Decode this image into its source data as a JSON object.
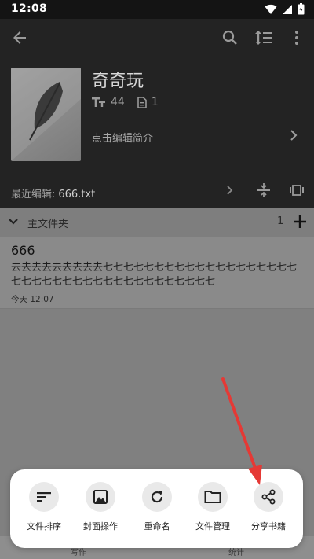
{
  "status_bar": {
    "time": "12:08"
  },
  "toolbar": {
    "icons": [
      "back-arrow-icon",
      "search-icon",
      "sort-icon",
      "more-vert-icon"
    ]
  },
  "book": {
    "title": "奇奇玩",
    "word_count": "44",
    "file_count": "1",
    "intro": "点击编辑简介",
    "recent_label": "最近编辑:",
    "recent_file": "666.txt"
  },
  "folder": {
    "name": "主文件夹",
    "count": "1"
  },
  "file": {
    "title": "666",
    "preview": "去去去去去去去去去七七七七七七七七七七七七七七七七七七七七七七七七七七七七七七七七七七七七七七七",
    "date": "今天 12:07"
  },
  "bottom_nav": {
    "left": "写作",
    "right": "统计"
  },
  "actions": [
    {
      "label": "文件排序",
      "icon": "sort-lines-icon"
    },
    {
      "label": "封面操作",
      "icon": "image-icon"
    },
    {
      "label": "重命名",
      "icon": "refresh-icon"
    },
    {
      "label": "文件管理",
      "icon": "folder-icon"
    },
    {
      "label": "分享书籍",
      "icon": "share-icon"
    }
  ],
  "colors": {
    "header_bg": "#232323",
    "overlay": "#808080",
    "sheet_bg": "#ffffff",
    "annotation_arrow": "#e53935"
  }
}
